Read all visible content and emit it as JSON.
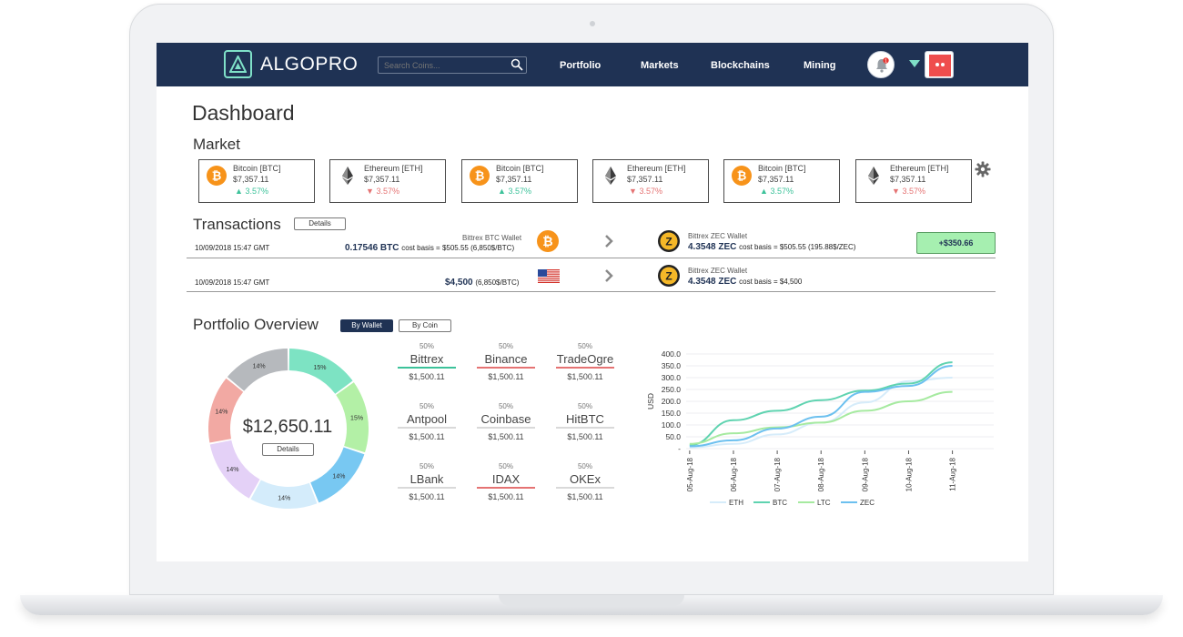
{
  "app": {
    "name": "ALGOPRO"
  },
  "nav": {
    "search_placeholder": "Search Coins...",
    "links": [
      "Portfolio",
      "Markets",
      "Blockchains",
      "Mining"
    ],
    "notification_count": "1"
  },
  "page_title": "Dashboard",
  "market": {
    "title": "Market",
    "cards": [
      {
        "name": "Bitcoin [BTC]",
        "price": "$7,357.11",
        "change": "3.57%",
        "direction": "up",
        "icon": "bitcoin-icon"
      },
      {
        "name": "Ethereum [ETH]",
        "price": "$7,357.11",
        "change": "3.57%",
        "direction": "down",
        "icon": "ethereum-icon"
      },
      {
        "name": "Bitcoin [BTC]",
        "price": "$7,357.11",
        "change": "3.57%",
        "direction": "up",
        "icon": "bitcoin-icon"
      },
      {
        "name": "Ethereum [ETH]",
        "price": "$7,357.11",
        "change": "3.57%",
        "direction": "down",
        "icon": "ethereum-icon"
      },
      {
        "name": "Bitcoin [BTC]",
        "price": "$7,357.11",
        "change": "3.57%",
        "direction": "up",
        "icon": "bitcoin-icon"
      },
      {
        "name": "Ethereum [ETH]",
        "price": "$7,357.11",
        "change": "3.57%",
        "direction": "down",
        "icon": "ethereum-icon"
      }
    ]
  },
  "transactions": {
    "title": "Transactions",
    "details_label": "Details",
    "rows": [
      {
        "date": "10/09/2018 15:47 GMT",
        "from_wallet": "Bittrex BTC Wallet",
        "from_amount": "0.17546 BTC",
        "from_basis": "cost basis = $505.55 (6,850$/BTC)",
        "to_wallet": "Bittrex ZEC Wallet",
        "to_amount": "4.3548 ZEC",
        "to_basis": "cost basis = $505.55 (195.88$/ZEC)",
        "gain": "+$350.66"
      },
      {
        "date": "10/09/2018 15:47 GMT",
        "from_wallet": "",
        "from_amount": "$4,500",
        "from_basis": "(6,850$/BTC)",
        "to_wallet": "Bittrex ZEC Wallet",
        "to_amount": "4.3548 ZEC",
        "to_basis": "cost basis = $4,500"
      }
    ]
  },
  "portfolio": {
    "title": "Portfolio Overview",
    "tabs": [
      "By Wallet",
      "By Coin"
    ],
    "active_tab": "By Wallet",
    "total": "$12,650.11",
    "details_label": "Details",
    "donut": [
      {
        "label": "15%",
        "value": 15,
        "color": "#7de3c3"
      },
      {
        "label": "15%",
        "value": 15,
        "color": "#b3f0a6"
      },
      {
        "label": "14%",
        "value": 14,
        "color": "#78c8f2"
      },
      {
        "label": "14%",
        "value": 14,
        "color": "#d4ecfb"
      },
      {
        "label": "14%",
        "value": 14,
        "color": "#e4d1f7"
      },
      {
        "label": "14%",
        "value": 14,
        "color": "#f2a9a3"
      },
      {
        "label": "14%",
        "value": 14,
        "color": "#b6b9bd"
      }
    ],
    "exchanges": [
      {
        "pct": "50%",
        "name": "Bittrex",
        "value": "$1,500.11",
        "underline": "#3cc29a"
      },
      {
        "pct": "50%",
        "name": "Binance",
        "value": "$1,500.11",
        "underline": "#e57373"
      },
      {
        "pct": "50%",
        "name": "TradeOgre",
        "value": "$1,500.11",
        "underline": "#e57373"
      },
      {
        "pct": "50%",
        "name": "Antpool",
        "value": "$1,500.11",
        "underline": "#d9d9d9"
      },
      {
        "pct": "50%",
        "name": "Coinbase",
        "value": "$1,500.11",
        "underline": "#d9d9d9"
      },
      {
        "pct": "50%",
        "name": "HitBTC",
        "value": "$1,500.11",
        "underline": "#d9d9d9"
      },
      {
        "pct": "50%",
        "name": "LBank",
        "value": "$1,500.11",
        "underline": "#d9d9d9"
      },
      {
        "pct": "50%",
        "name": "IDAX",
        "value": "$1,500.11",
        "underline": "#e57373"
      },
      {
        "pct": "50%",
        "name": "OKEx",
        "value": "$1,500.11",
        "underline": "#d9d9d9"
      }
    ]
  },
  "chart_data": {
    "type": "line",
    "ylabel": "USD",
    "xlabel": "",
    "ylim": [
      0,
      400
    ],
    "yticks": [
      "400.0",
      "350.0",
      "300.0",
      "250.0",
      "200.0",
      "150.0",
      "100.0",
      "50.0",
      "-"
    ],
    "categories": [
      "05-Aug-18",
      "06-Aug-18",
      "07-Aug-18",
      "08-Aug-18",
      "09-Aug-18",
      "10-Aug-18",
      "11-Aug-18"
    ],
    "legend_position": "bottom",
    "series": [
      {
        "name": "ETH",
        "color": "#d6ecfa",
        "values": [
          5,
          20,
          60,
          110,
          195,
          285,
          300
        ]
      },
      {
        "name": "BTC",
        "color": "#5fd3b0",
        "values": [
          15,
          120,
          160,
          205,
          245,
          275,
          365
        ]
      },
      {
        "name": "LTC",
        "color": "#a6eaa0",
        "values": [
          20,
          65,
          90,
          110,
          160,
          200,
          240
        ]
      },
      {
        "name": "ZEC",
        "color": "#6cc0ef",
        "values": [
          10,
          35,
          85,
          135,
          240,
          265,
          350
        ]
      }
    ]
  }
}
